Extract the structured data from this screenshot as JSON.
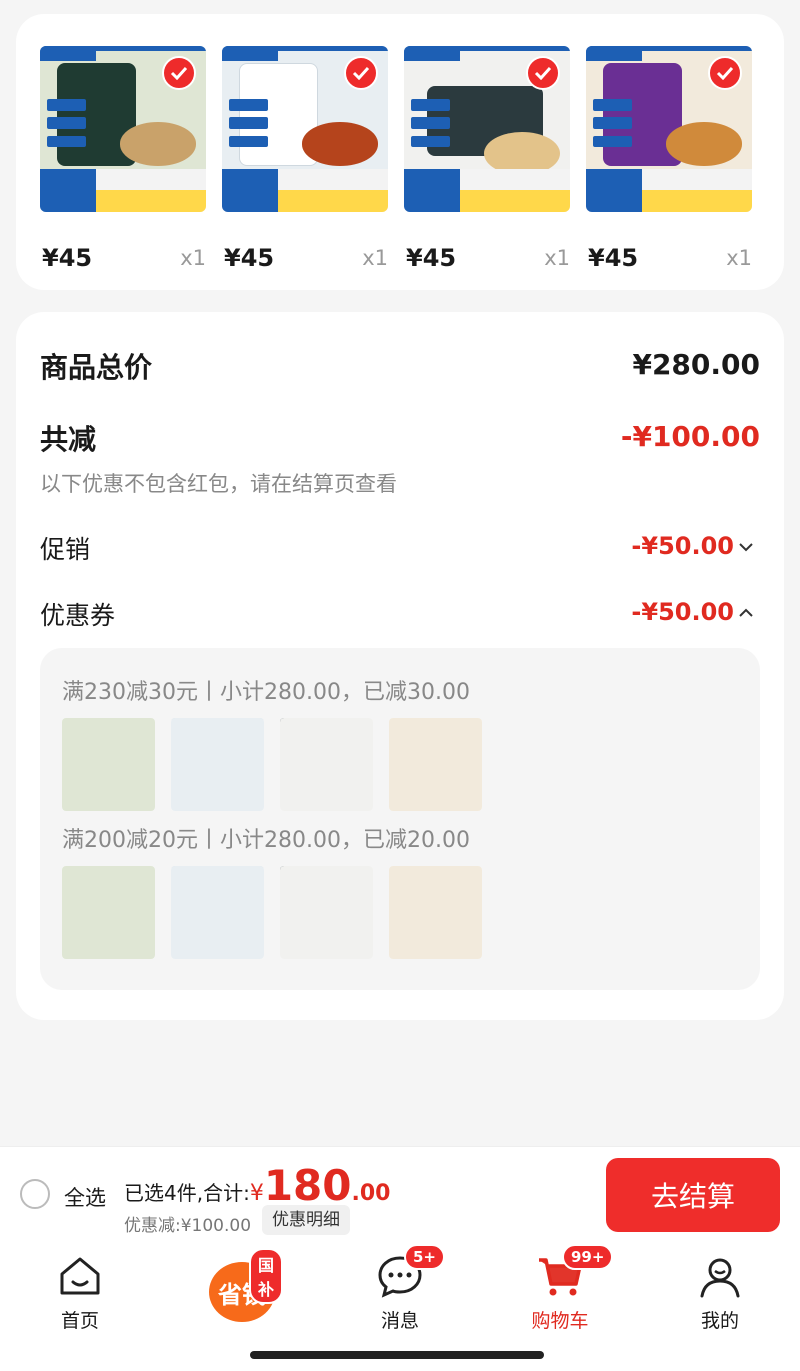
{
  "products": [
    {
      "price": "¥45",
      "qty": "x1",
      "bag_color": "#1f3b32",
      "food_color": "#c9a26a",
      "bg": "#dfe6d4"
    },
    {
      "price": "¥45",
      "qty": "x1",
      "bag_color": "#eef2f5",
      "food_color": "#b5441c",
      "bg": "#e8eef2"
    },
    {
      "price": "¥45",
      "qty": "x1",
      "bag_color": "#2b3a3e",
      "food_color": "#e3c38a",
      "bg": "#f1f1ef"
    },
    {
      "price": "¥45",
      "qty": "x1",
      "bag_color": "#6a2f94",
      "food_color": "#d08a3b",
      "bg": "#f2eadc"
    }
  ],
  "summary": {
    "total_label": "商品总价",
    "total_value": "¥280.00",
    "reduce_label": "共减",
    "reduce_value": "-¥100.00",
    "note": "以下优惠不包含红包，请在结算页查看",
    "promo_label": "促销",
    "promo_value": "-¥50.00",
    "coupon_label": "优惠券",
    "coupon_value": "-¥50.00"
  },
  "coupons": [
    {
      "title": "满230减30元丨小计280.00，已减30.00"
    },
    {
      "title": "满200减20元丨小计280.00，已减20.00"
    }
  ],
  "bottom": {
    "select_all": "全选",
    "selected_text": "已选4件,合计:",
    "currency": "¥",
    "total_int": "180",
    "total_dec": ".00",
    "discount": "优惠减:¥100.00",
    "detail_button": "优惠明细",
    "checkout_button": "去结算"
  },
  "tabs": [
    {
      "label": "首页"
    },
    {
      "label": "省钱",
      "badge": "国补"
    },
    {
      "label": "消息",
      "badge": "5+"
    },
    {
      "label": "购物车",
      "badge": "99+"
    },
    {
      "label": "我的"
    }
  ],
  "colors": {
    "accent": "#e02a20",
    "button": "#ef2d2b",
    "active_tab": "#e02a20"
  }
}
